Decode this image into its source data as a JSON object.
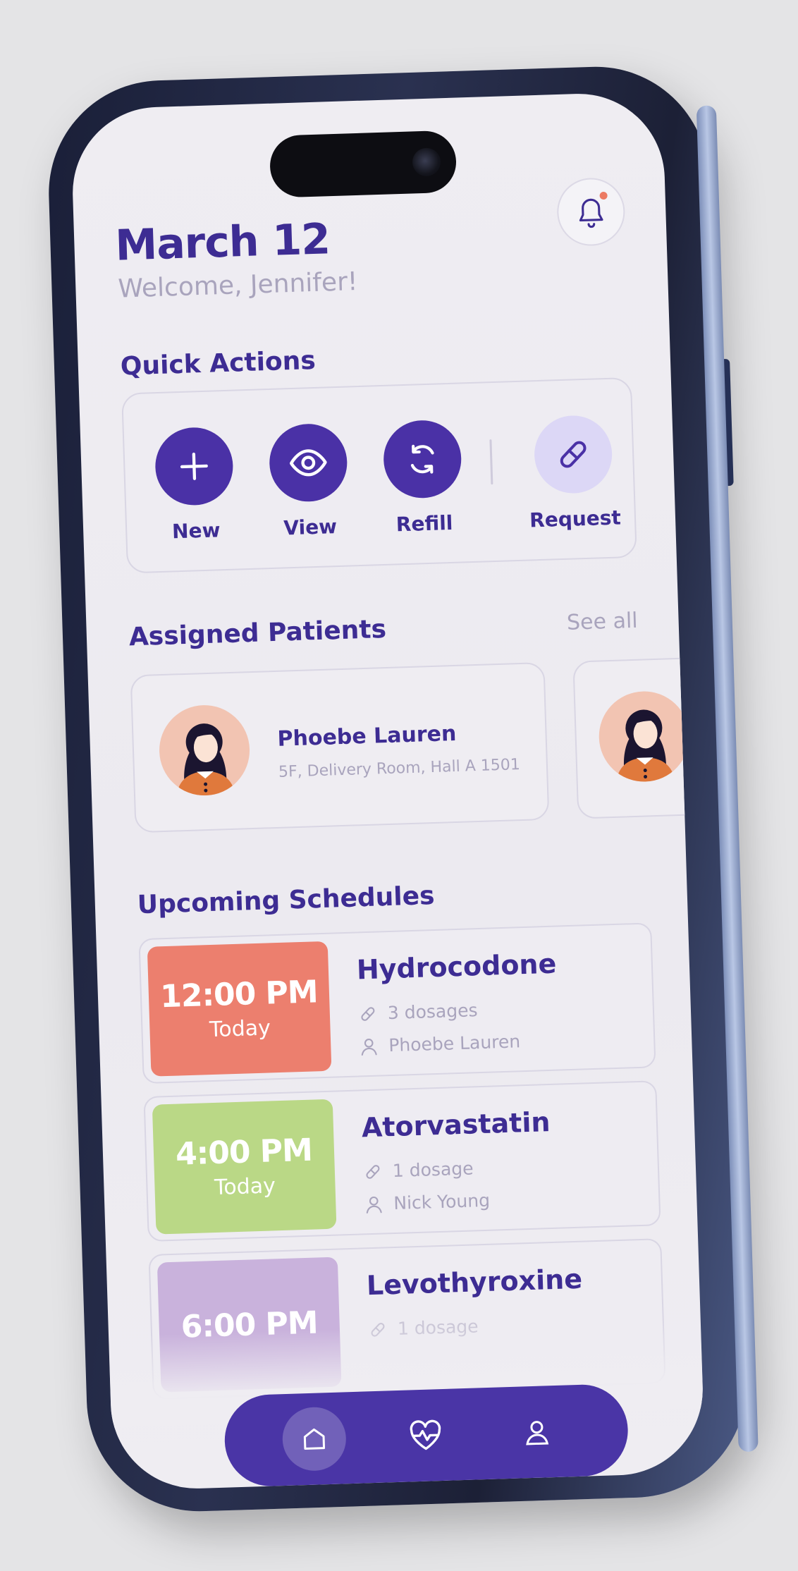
{
  "header": {
    "date": "March 12",
    "welcome": "Welcome, Jennifer!",
    "notification_unread": true
  },
  "quick_actions": {
    "title": "Quick Actions",
    "items": [
      {
        "label": "New",
        "icon": "plus-icon"
      },
      {
        "label": "View",
        "icon": "eye-icon"
      },
      {
        "label": "Refill",
        "icon": "refresh-icon"
      },
      {
        "label": "Request",
        "icon": "pill-icon"
      }
    ]
  },
  "patients": {
    "title": "Assigned Patients",
    "see_all": "See all",
    "items": [
      {
        "name": "Phoebe Lauren",
        "room": "5F, Delivery Room, Hall A 1501"
      }
    ]
  },
  "schedules": {
    "title": "Upcoming Schedules",
    "items": [
      {
        "time": "12:00 PM",
        "day": "Today",
        "medication": "Hydrocodone",
        "dosage": "3 dosages",
        "patient": "Phoebe Lauren",
        "color": "#ec7f6e"
      },
      {
        "time": "4:00 PM",
        "day": "Today",
        "medication": "Atorvastatin",
        "dosage": "1 dosage",
        "patient": "Nick Young",
        "color": "#bad886"
      },
      {
        "time": "6:00 PM",
        "day": "",
        "medication": "Levothyroxine",
        "dosage": "1 dosage",
        "patient": "",
        "color": "#c9b2dc"
      }
    ]
  },
  "nav": {
    "items": [
      {
        "icon": "home-icon",
        "active": true
      },
      {
        "icon": "heart-pulse-icon",
        "active": false
      },
      {
        "icon": "user-icon",
        "active": false
      }
    ]
  },
  "colors": {
    "primary": "#4a31a6",
    "heading": "#3d2c93",
    "muted": "#a9a4bd",
    "accent_light": "#dcd7f6",
    "badge": "#ec7a63"
  }
}
